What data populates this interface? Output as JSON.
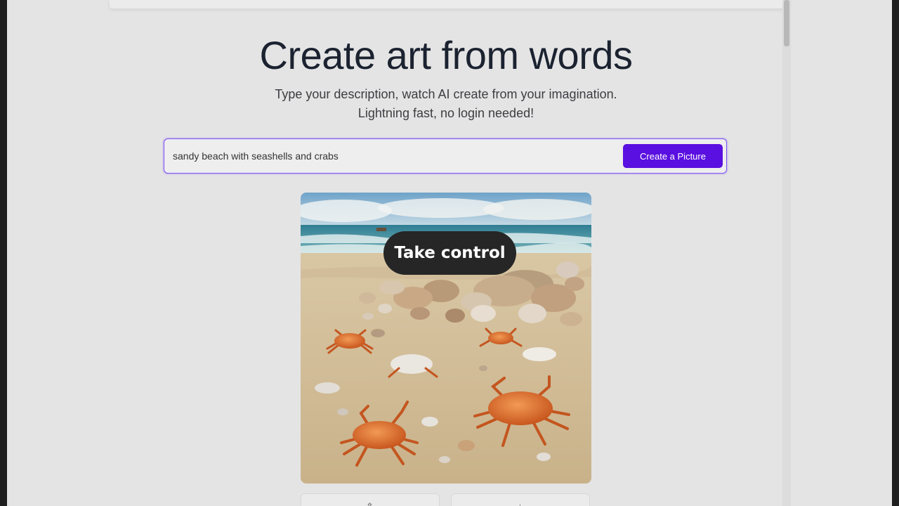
{
  "hero": {
    "title": "Create art from words",
    "subtitle_line1": "Type your description, watch AI create from your imagination.",
    "subtitle_line2": "Lightning fast, no login needed!"
  },
  "prompt": {
    "value": "sandy beach with seashells and crabs",
    "button_label": "Create a Picture"
  },
  "result": {
    "image_subject": "sandy beach with seashells and crabs",
    "overlay_label": "Take control"
  },
  "actions": {
    "icons": [
      "share-icon",
      "download-icon"
    ]
  },
  "colors": {
    "accent": "#5a10e0",
    "overlay": "#262626",
    "page_background": "#e4e4e4"
  }
}
